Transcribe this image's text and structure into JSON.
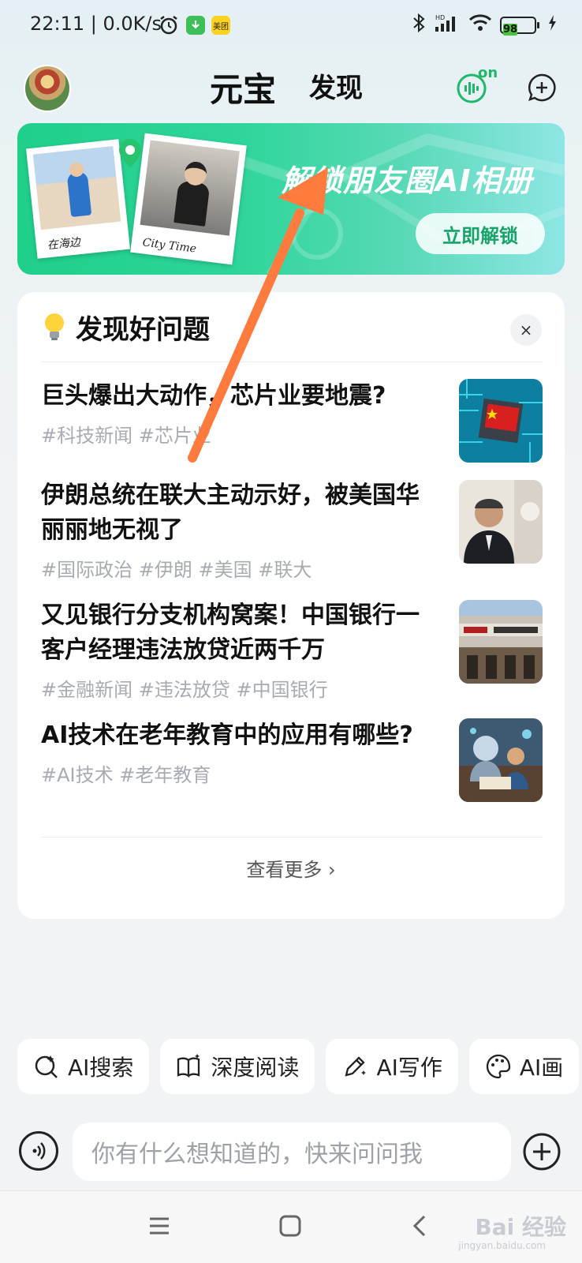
{
  "status_bar": {
    "time": "22:11 | 0.0K/s",
    "battery": "98",
    "app_badge": "美团"
  },
  "header": {
    "tabs": [
      "元宝",
      "发现"
    ],
    "voice_badge": "on"
  },
  "banner": {
    "title": "解锁朋友圈AI相册",
    "button": "立即解锁",
    "photo_captions": [
      "在海边",
      "City Time"
    ]
  },
  "discover": {
    "title": "发现好问题",
    "close": "×",
    "questions": [
      {
        "text": "巨头爆出大动作，芯片业要地震?",
        "tags": "#科技新闻 #芯片业",
        "image": "chip-flag-image"
      },
      {
        "text": "伊朗总统在联大主动示好，被美国华丽丽地无视了",
        "tags": "#国际政治 #伊朗 #美国 #联大",
        "image": "politician-image"
      },
      {
        "text": "又见银行分支机构窝案！中国银行一客户经理违法放贷近两千万",
        "tags": "#金融新闻 #违法放贷 #中国银行",
        "image": "bank-building-image"
      },
      {
        "text": "AI技术在老年教育中的应用有哪些?",
        "tags": "#AI技术 #老年教育",
        "image": "ai-education-image"
      }
    ],
    "see_more": "查看更多 ›"
  },
  "chips": [
    {
      "label": "AI搜索",
      "icon": "search-sparkle-icon"
    },
    {
      "label": "深度阅读",
      "icon": "book-sparkle-icon"
    },
    {
      "label": "AI写作",
      "icon": "pen-icon"
    },
    {
      "label": "AI画",
      "icon": "palette-icon"
    }
  ],
  "input": {
    "placeholder": "你有什么想知道的，快来问问我"
  },
  "watermark": {
    "main": "Bai 经验",
    "sub": "jingyan.baidu.com"
  },
  "colors": {
    "accent_green": "#17a36a",
    "annotation_arrow": "#ff7a3d"
  }
}
